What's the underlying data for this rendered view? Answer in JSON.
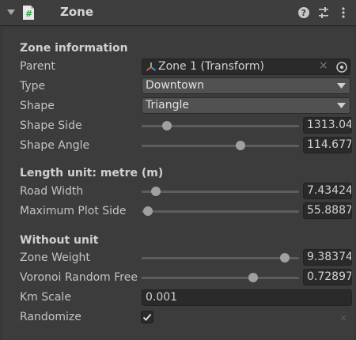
{
  "component": {
    "title": "Zone",
    "icons": {
      "fold": "triangle-down-icon",
      "script": "csharp-script-icon",
      "help": "help-icon",
      "presets": "sliders-icon",
      "menu": "kebab-menu-icon"
    }
  },
  "sections": {
    "zone_information": "Zone information",
    "length_unit": "Length unit: metre (m)",
    "without_unit": "Without unit"
  },
  "fields": {
    "parent": {
      "label": "Parent",
      "value": "Zone 1 (Transform)",
      "clear": "×"
    },
    "type": {
      "label": "Type",
      "value": "Downtown"
    },
    "shape": {
      "label": "Shape",
      "value": "Triangle"
    },
    "shape_side": {
      "label": "Shape Side",
      "value": "1313.04",
      "fraction": 0.16
    },
    "shape_angle": {
      "label": "Shape Angle",
      "value": "114.677",
      "fraction": 0.63
    },
    "road_width": {
      "label": "Road Width",
      "value": "7.43424",
      "fraction": 0.09
    },
    "max_plot_side": {
      "label": "Maximum Plot Side",
      "value": "55.8887",
      "fraction": 0.04
    },
    "zone_weight": {
      "label": "Zone Weight",
      "value": "9.38374",
      "fraction": 0.91
    },
    "voronoi": {
      "label": "Voronoi Random Free",
      "value": "0.72897",
      "fraction": 0.71
    },
    "km_scale": {
      "label": "Km Scale",
      "value": "0.001"
    },
    "randomize": {
      "label": "Randomize",
      "checked": true,
      "reset": "×"
    }
  },
  "colors": {
    "background": "#383838",
    "field": "#2a2a2a",
    "dropdown": "#515151",
    "thumb": "#a0a0a0",
    "script_green": "#3aa14a"
  }
}
